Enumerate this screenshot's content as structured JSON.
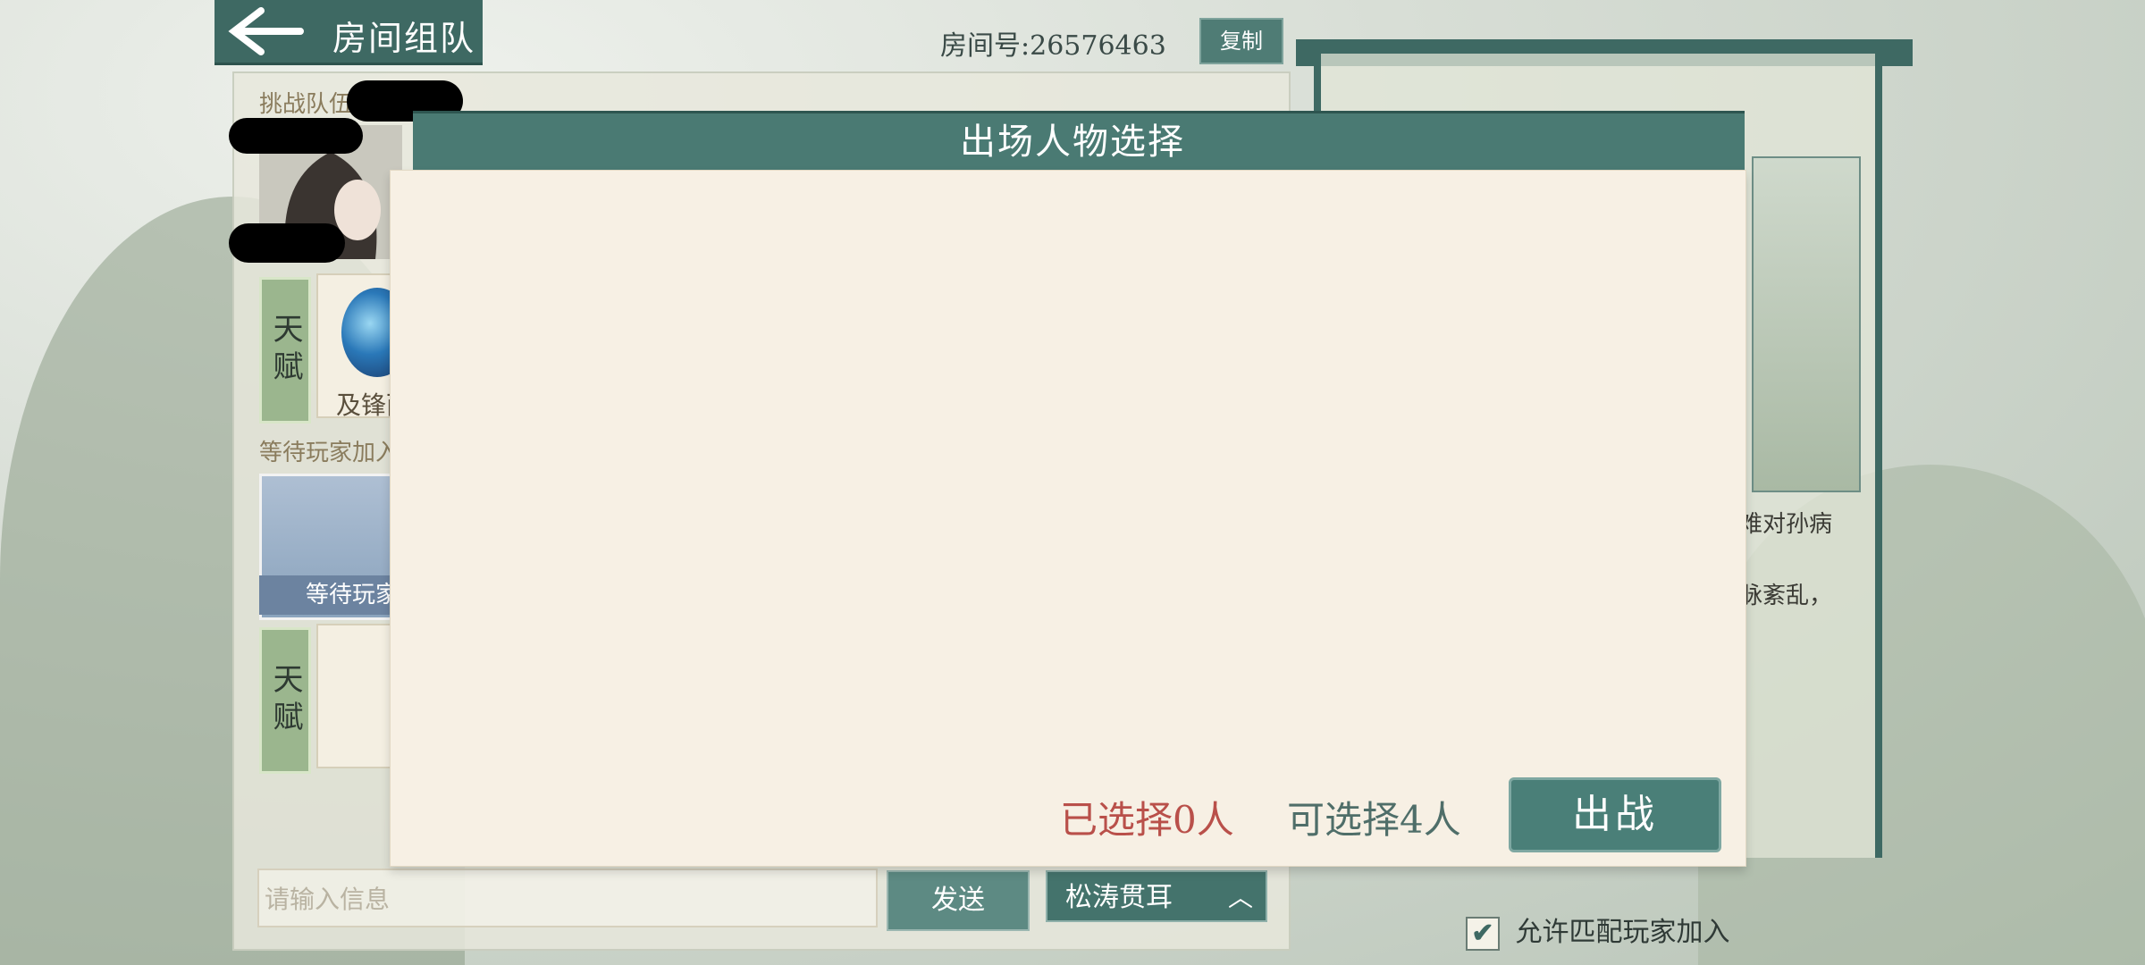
{
  "header": {
    "title": "房间组队",
    "room_number": "房间号:26576463",
    "copy_label": "复制"
  },
  "team": {
    "label": "挑战队伍",
    "talent_label": "天赋",
    "skill_name": "及锋而",
    "waiting_label": "等待玩家加入",
    "waiting_card_label": "等待玩家"
  },
  "dialog": {
    "title": "出场人物选择",
    "selected_text": "已选择0人",
    "available_text": "可选择4人",
    "battle_label": "出战"
  },
  "chat": {
    "placeholder": "请输入信息",
    "send_label": "发送",
    "phrase": "松涛贯耳"
  },
  "right_panel": {
    "text_line1": "难对孙病",
    "text_line2": "脉紊乱，",
    "allow_match_label": "允许匹配玩家加入",
    "allow_match_checked": true
  }
}
